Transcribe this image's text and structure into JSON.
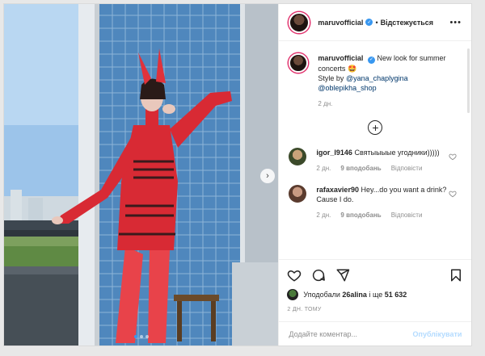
{
  "header": {
    "username": "maruvofficial",
    "separator": "•",
    "follow_label": "Відстежується",
    "more_label": "•••"
  },
  "caption": {
    "username": "maruvofficial",
    "text_part": "New look for summer concerts",
    "emoji": "🤩",
    "style_by_label": "Style by",
    "mention_1": "@yana_chaplygina",
    "mention_2": "@oblepikha_shop",
    "time": "2 дн."
  },
  "comments": [
    {
      "username": "igor_l9146",
      "text": "Святыыыые угодники)))))",
      "time": "2 дн.",
      "likes": "9 вподобань",
      "reply_label": "Відповісти"
    },
    {
      "username": "rafaxavier90",
      "text": "Hey...do you want a drink? Cause I do.",
      "time": "2 дн.",
      "likes": "9 вподобань",
      "reply_label": "Відповісти"
    }
  ],
  "likes": {
    "prefix": "Уподобали",
    "user": "26alina",
    "middle": "і ще",
    "count": "51 632"
  },
  "post_date": "2 ДН. ТОМУ",
  "comment_input": {
    "placeholder": "Додайте коментар..."
  },
  "publish_label": "Опублікувати",
  "carousel": {
    "next_label": "›",
    "slides_total": 3,
    "current_slide": 1
  },
  "colors": {
    "accent_blue": "#3897f0",
    "link": "#00376b",
    "publish_disabled": "#b3dbff",
    "outfit_red": "#d82a34"
  },
  "icons": [
    "heart-icon",
    "comment-icon",
    "share-icon",
    "bookmark-icon",
    "add-comments-icon",
    "verified-icon",
    "next-arrow-icon"
  ]
}
